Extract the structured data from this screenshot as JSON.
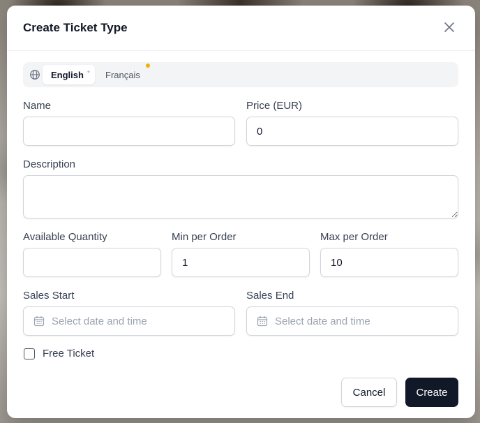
{
  "dialog": {
    "title": "Create Ticket Type"
  },
  "language_tabs": {
    "items": [
      {
        "label": "English",
        "marker": "*",
        "active": true
      },
      {
        "label": "Français",
        "active": false,
        "has_indicator": true
      }
    ],
    "indicator_color": "#eab308"
  },
  "fields": {
    "name": {
      "label": "Name",
      "value": "",
      "placeholder": ""
    },
    "price": {
      "label": "Price (EUR)",
      "value": "0",
      "placeholder": ""
    },
    "description": {
      "label": "Description",
      "value": "",
      "placeholder": ""
    },
    "available_quantity": {
      "label": "Available Quantity",
      "value": "",
      "placeholder": ""
    },
    "min_per_order": {
      "label": "Min per Order",
      "value": "1",
      "placeholder": ""
    },
    "max_per_order": {
      "label": "Max per Order",
      "value": "10",
      "placeholder": ""
    },
    "sales_start": {
      "label": "Sales Start",
      "placeholder": "Select date and time"
    },
    "sales_end": {
      "label": "Sales End",
      "placeholder": "Select date and time"
    },
    "free_ticket": {
      "label": "Free Ticket",
      "checked": false
    }
  },
  "actions": {
    "cancel_label": "Cancel",
    "create_label": "Create"
  },
  "icons": {
    "close": "close-icon",
    "language": "globe-icon",
    "date": "calendar-icon"
  },
  "colors": {
    "primary_button": "#111827",
    "dialog_background": "#ffffff"
  }
}
